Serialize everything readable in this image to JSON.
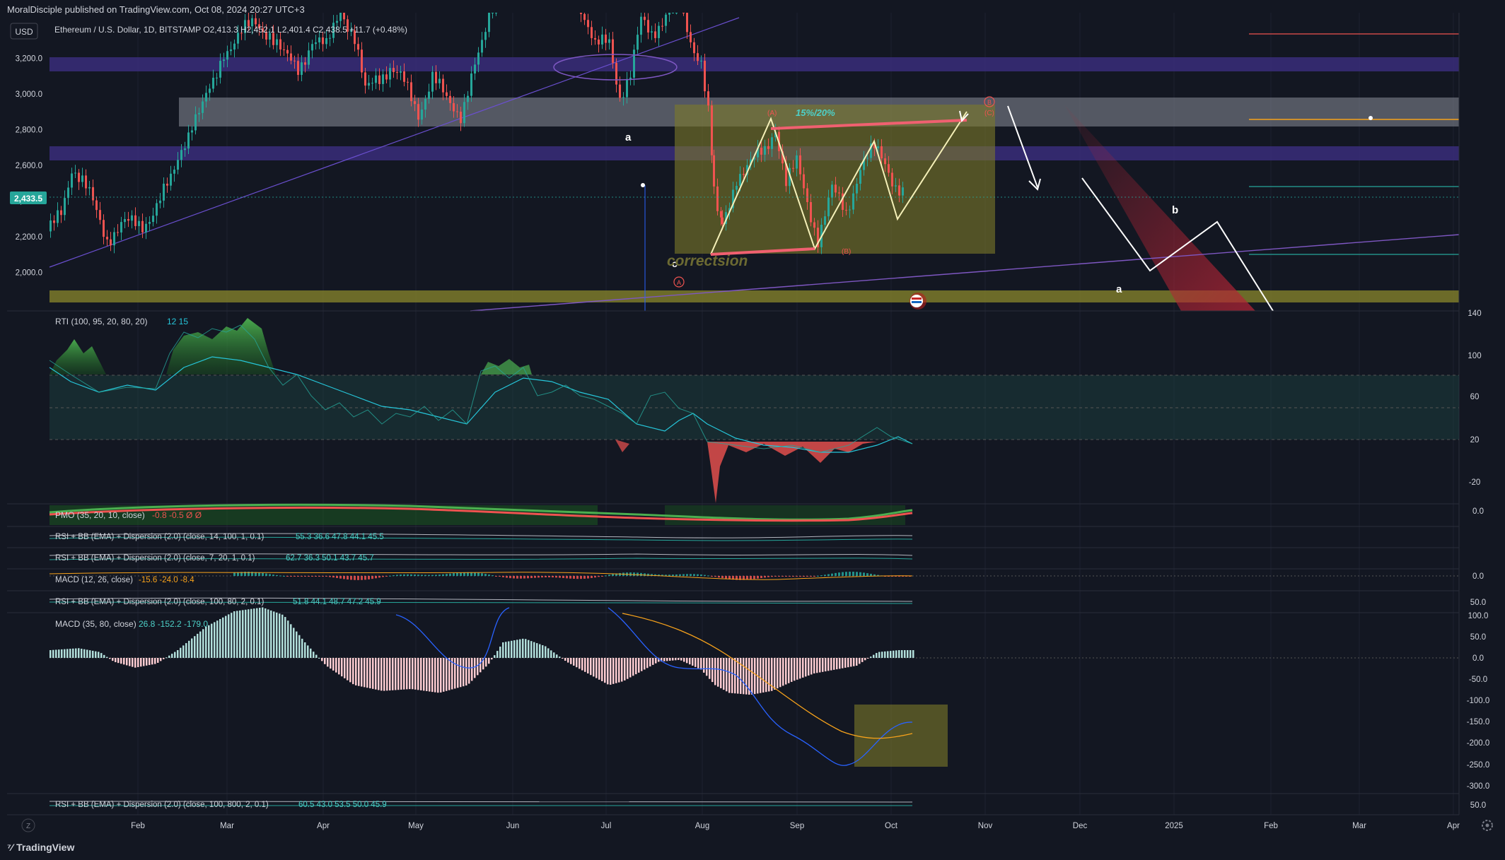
{
  "publisher": "MoralDisciple published on TradingView.com, Oct 08, 2024 20:27 UTC+3",
  "brand": "TradingView",
  "currency_button": "USD",
  "symbol_legend": "Ethereum / U.S. Dollar, 1D, BITSTAMP  O2,413.3  H2,452.1  L2,401.4  C2,438.5  +11.7 (+0.48%)",
  "last_price_badge": "2,433.5",
  "price_axis": {
    "ticks": [
      "3,200.0",
      "3,000.0",
      "2,800.0",
      "2,600.0",
      "2,400.0",
      "2,200.0",
      "2,000.0"
    ],
    "values": [
      3200,
      3000,
      2800,
      2600,
      2400,
      2200,
      2000
    ]
  },
  "time_axis": {
    "labels": [
      "Feb",
      "Mar",
      "Apr",
      "May",
      "Jun",
      "Jul",
      "Aug",
      "Sep",
      "Oct",
      "Nov",
      "Dec",
      "2025",
      "Feb",
      "Mar",
      "Apr"
    ],
    "reset_label": "Z"
  },
  "annotations": {
    "wave_a_left": "a",
    "wave_c": "c",
    "correction": "correctsion",
    "percent": "15%/20%",
    "label_A": "(A)",
    "label_B": "(B)",
    "label_C": "(C)",
    "circle_A": "A",
    "circle_B": "B",
    "wave_b_right": "b",
    "wave_a_right": "a"
  },
  "indicators": {
    "rti": {
      "legend_name": "RTI (100, 95, 20, 80, 20)",
      "values": "12  15",
      "axis": [
        "140",
        "100",
        "60",
        "20",
        "-20"
      ]
    },
    "pmo": {
      "legend_name": "PMO (35, 20, 10, close)",
      "values": "-0.8  -0.5  Ø Ø",
      "axis": [
        "0.0"
      ]
    },
    "rsi_bb_1": {
      "legend_name": "RSI + BB (EMA) + Dispersion (2.0) (close, 14, 100, 1, 0.1)",
      "values": "55.3  36.6  47.8  44.1  45.5"
    },
    "rsi_bb_2": {
      "legend_name": "RSI + BB (EMA) + Dispersion (2.0) (close, 7, 20, 1, 0.1)",
      "values": "62.7  36.3  50.1  43.7  45.7"
    },
    "macd_small": {
      "legend_name": "MACD (12, 26, close)",
      "values": "-15.6  -24.0  -8.4",
      "axis": [
        "0.0"
      ]
    },
    "rsi_bb_3": {
      "legend_name": "RSI + BB (EMA) + Dispersion (2.0) (close, 100, 80, 2, 0.1)",
      "values": "51.8  44.1  48.7  47.2  45.9",
      "axis": [
        "50.0"
      ]
    },
    "macd_big": {
      "legend_name": "MACD (35, 80, close)",
      "values": "26.8  -152.2  -179.0",
      "axis": [
        "100.0",
        "50.0",
        "0.0",
        "-50.0",
        "-100.0",
        "-150.0",
        "-200.0",
        "-250.0",
        "-300.0"
      ]
    },
    "rsi_bb_4": {
      "legend_name": "RSI + BB (EMA) + Dispersion (2.0) (close, 100, 800, 2, 0.1)",
      "values": "60.5  43.0  53.5  50.0  45.9",
      "axis": [
        "50.0"
      ]
    }
  },
  "colors": {
    "background": "#131722",
    "up": "#26a69a",
    "down": "#ef5350",
    "text": "#b2b5be",
    "purple_zone": "#3a2d7a",
    "grey_zone": "#8a8e99",
    "yellow_zone": "#7d7a2a"
  }
}
